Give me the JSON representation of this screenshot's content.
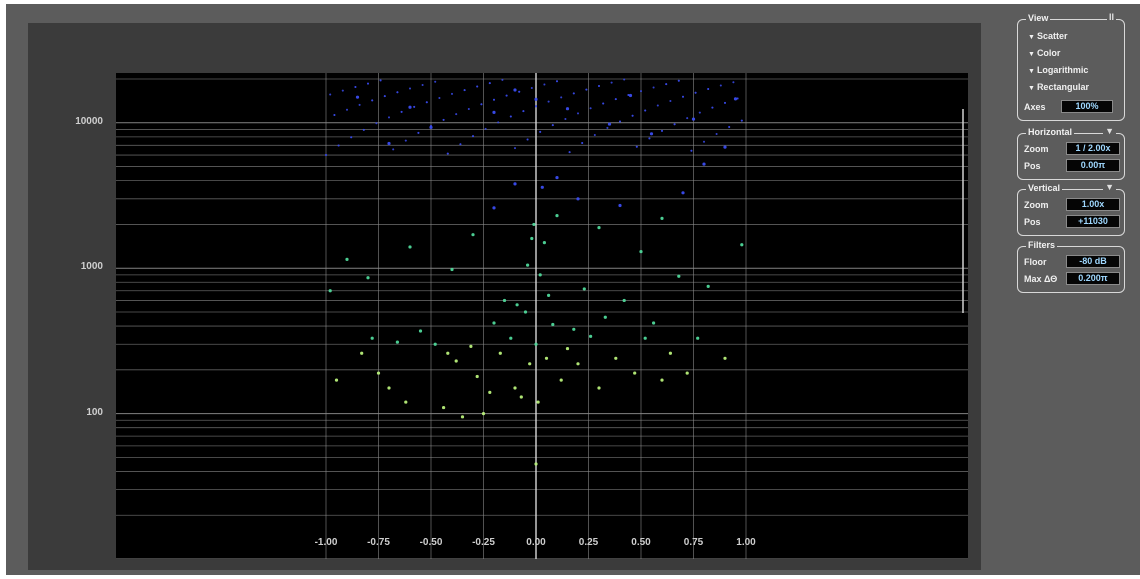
{
  "chart_data": {
    "type": "scatter",
    "y_scale": "log",
    "ylim": [
      10,
      22000
    ],
    "xlim": [
      -1.0,
      1.0
    ],
    "y_ticks": [
      "10000",
      "1000",
      "100"
    ],
    "x_ticks": [
      "-1.00",
      "-0.75",
      "-0.50",
      "-0.25",
      "0.00",
      "0.25",
      "0.50",
      "0.75",
      "1.00"
    ],
    "grid": true,
    "colors": {
      "background": "#000000",
      "grid": "#8a8a8a",
      "low_freq_points": "#b8f07a",
      "mid_freq_points": "#4fd89a",
      "high_freq_points": "#3a4cf0"
    },
    "points": [
      [
        -0.95,
        170
      ],
      [
        -0.83,
        260
      ],
      [
        -0.78,
        330
      ],
      [
        -0.75,
        190
      ],
      [
        -0.7,
        150
      ],
      [
        -0.66,
        310
      ],
      [
        -0.62,
        120
      ],
      [
        -0.55,
        370
      ],
      [
        -0.48,
        300
      ],
      [
        -0.44,
        110
      ],
      [
        -0.42,
        260
      ],
      [
        -0.38,
        230
      ],
      [
        -0.35,
        95
      ],
      [
        -0.31,
        290
      ],
      [
        -0.28,
        180
      ],
      [
        -0.25,
        100
      ],
      [
        -0.22,
        140
      ],
      [
        -0.2,
        420
      ],
      [
        -0.17,
        260
      ],
      [
        -0.15,
        600
      ],
      [
        -0.12,
        330
      ],
      [
        -0.1,
        150
      ],
      [
        -0.09,
        560
      ],
      [
        -0.07,
        130
      ],
      [
        -0.05,
        500
      ],
      [
        -0.04,
        1050
      ],
      [
        -0.03,
        220
      ],
      [
        -0.02,
        1600
      ],
      [
        -0.01,
        2000
      ],
      [
        0.0,
        300
      ],
      [
        0.0,
        45
      ],
      [
        0.01,
        120
      ],
      [
        0.02,
        900
      ],
      [
        0.03,
        3600
      ],
      [
        0.04,
        1500
      ],
      [
        0.05,
        240
      ],
      [
        0.06,
        650
      ],
      [
        0.08,
        410
      ],
      [
        0.1,
        2300
      ],
      [
        0.12,
        170
      ],
      [
        0.15,
        280
      ],
      [
        0.18,
        380
      ],
      [
        0.2,
        220
      ],
      [
        0.23,
        720
      ],
      [
        0.26,
        340
      ],
      [
        0.3,
        150
      ],
      [
        0.33,
        460
      ],
      [
        0.38,
        240
      ],
      [
        0.42,
        600
      ],
      [
        0.47,
        190
      ],
      [
        0.52,
        330
      ],
      [
        0.56,
        420
      ],
      [
        0.6,
        170
      ],
      [
        0.64,
        260
      ],
      [
        0.68,
        880
      ],
      [
        0.72,
        190
      ],
      [
        0.77,
        330
      ],
      [
        0.82,
        750
      ],
      [
        0.9,
        240
      ],
      [
        0.98,
        1450
      ],
      [
        -0.98,
        700
      ],
      [
        -0.9,
        1150
      ],
      [
        -0.8,
        860
      ],
      [
        -0.6,
        1400
      ],
      [
        -0.4,
        980
      ],
      [
        -0.3,
        1700
      ],
      [
        -0.2,
        2600
      ],
      [
        -0.1,
        3800
      ],
      [
        0.1,
        4200
      ],
      [
        0.2,
        3000
      ],
      [
        0.3,
        1900
      ],
      [
        0.4,
        2700
      ],
      [
        0.5,
        1300
      ],
      [
        0.6,
        2200
      ],
      [
        0.7,
        3300
      ],
      [
        0.8,
        5200
      ],
      [
        0.9,
        6800
      ],
      [
        -0.7,
        7200
      ],
      [
        -0.5,
        9300
      ],
      [
        -0.2,
        11800
      ],
      [
        0.0,
        14500
      ],
      [
        0.15,
        12500
      ],
      [
        0.35,
        9800
      ],
      [
        0.55,
        8400
      ],
      [
        0.75,
        10600
      ],
      [
        -0.85,
        15000
      ],
      [
        -0.6,
        12800
      ],
      [
        -0.1,
        16800
      ],
      [
        0.45,
        15400
      ],
      [
        0.95,
        14600
      ]
    ]
  },
  "panel": {
    "view": {
      "title": "View",
      "icon": "pause-icon",
      "icon_glyph": "II",
      "options": [
        "Scatter",
        "Color",
        "Logarithmic",
        "Rectangular"
      ],
      "axes_label": "Axes",
      "axes_value": "100%"
    },
    "horizontal": {
      "title": "Horizontal",
      "icon": "chevron-down-icon",
      "zoom_label": "Zoom",
      "zoom_value": "1 / 2.00x",
      "pos_label": "Pos",
      "pos_value": "0.00π"
    },
    "vertical": {
      "title": "Vertical",
      "icon": "chevron-down-icon",
      "zoom_label": "Zoom",
      "zoom_value": "1.00x",
      "pos_label": "Pos",
      "pos_value": "+11030"
    },
    "filters": {
      "title": "Filters",
      "floor_label": "Floor",
      "floor_value": "-80 dB",
      "max_label": "Max ΔΘ",
      "max_value": "0.200π"
    }
  }
}
